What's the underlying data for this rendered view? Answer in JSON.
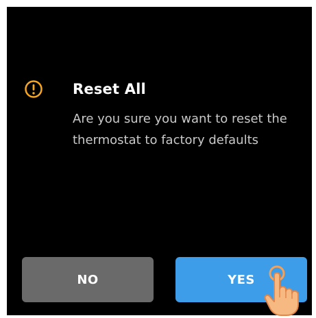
{
  "dialog": {
    "title": "Reset All",
    "message": "Are you sure you want to reset the thermostat to factory defaults",
    "icon": "warning-icon",
    "accent_color": "#F5A623"
  },
  "buttons": {
    "no_label": "NO",
    "yes_label": "YES",
    "no_color": "#6A6A6A",
    "yes_color": "#3D9DE8"
  },
  "overlay": {
    "icon": "tap-hand-icon"
  }
}
